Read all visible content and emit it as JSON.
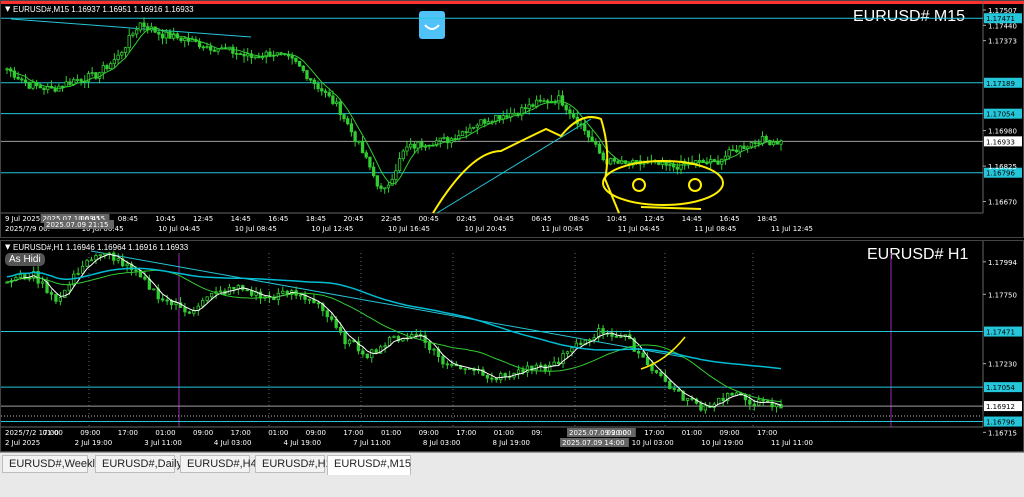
{
  "chart_top": {
    "header": "EURUSD#,M15  1.16937 1.16951 1.16916 1.16933",
    "symbol_label": "EURUSD# M15",
    "price_ticks": [
      "1.17507",
      "1.17440",
      "1.17373",
      "1.17189",
      "1.17054",
      "1.16980",
      "1.16933",
      "1.16825",
      "1.16796",
      "1.16670"
    ],
    "levels": [
      {
        "value": "1.17471",
        "color": "#26c6da"
      },
      {
        "value": "1.17189",
        "color": "#26c6da"
      },
      {
        "value": "1.17054",
        "color": "#26c6da"
      },
      {
        "value": "1.16933",
        "color": "#9e9e9e"
      },
      {
        "value": "1.16796",
        "color": "#26c6da"
      }
    ],
    "time_labels": [
      "9 Jul 2025",
      "2025.07.10 03:15",
      "06:45",
      "08:45",
      "10:45",
      "12:45",
      "14:45",
      "16:45",
      "18:45",
      "20:45",
      "22:45",
      "00:45",
      "02:45",
      "04:45",
      "06:45",
      "08:45",
      "10:45",
      "12:45",
      "14:45",
      "16:45",
      "18:45"
    ],
    "date_labels": [
      "2025/7/9 00:",
      "10 Jul 00:45",
      "10 Jul 04:45",
      "10 Jul 08:45",
      "10 Jul 12:45",
      "10 Jul 16:45",
      "10 Jul 20:45",
      "11 Jul 00:45",
      "11 Jul 04:45",
      "11 Jul 08:45",
      "11 Jul 12:45"
    ],
    "crosshair_date": "2025.07.09 21:15"
  },
  "chart_bottom": {
    "header": "EURUSD#,H1  1.16946 1.16964 1.16916 1.16933",
    "symbol_label": "EURUSD# H1",
    "button_label": "As Hidi",
    "price_ticks": [
      "1.17994",
      "1.17750",
      "1.17471",
      "1.17230",
      "1.17054",
      "1.16912",
      "1.16796",
      "1.16715"
    ],
    "levels": [
      {
        "value": "1.17471",
        "color": "#26c6da"
      },
      {
        "value": "1.17054",
        "color": "#26c6da"
      },
      {
        "value": "1.16912",
        "color": "#9e9e9e"
      },
      {
        "value": "1.16796",
        "color": "#26c6da"
      }
    ],
    "time_labels": [
      "2025/7/2 17:00",
      "01:00",
      "09:00",
      "17:00",
      "01:00",
      "09:00",
      "17:00",
      "01:00",
      "09:00",
      "17:00",
      "01:00",
      "09:00",
      "17:00",
      "01:00",
      "09:",
      "2025.07.09 20:00",
      "09:00",
      "17:00",
      "01:00",
      "09:00",
      "17:00"
    ],
    "date_labels": [
      "2 Jul 2025",
      "2 Jul 19:00",
      "3 Jul 11:00",
      "4 Jul 03:00",
      "4 Jul 19:00",
      "7 Jul 11:00",
      "8 Jul 03:00",
      "8 Jul 19:00",
      "2025.07.09 14:00",
      "10 Jul 03:00",
      "10 Jul 19:00",
      "11 Jul 11:00"
    ]
  },
  "tabs": [
    "EURUSD#,Weekly",
    "EURUSD#,Daily",
    "EURUSD#,H4",
    "EURUSD#,H1",
    "EURUSD#,M15"
  ],
  "active_tab": "EURUSD#,M15",
  "colors": {
    "background": "#000000",
    "bull": "#32cd32",
    "level": "#26c6da",
    "annotation": "#ffee00",
    "ma_white": "#ffffff",
    "ma_cyan": "#00bcd4",
    "border_red": "#ff3030"
  }
}
